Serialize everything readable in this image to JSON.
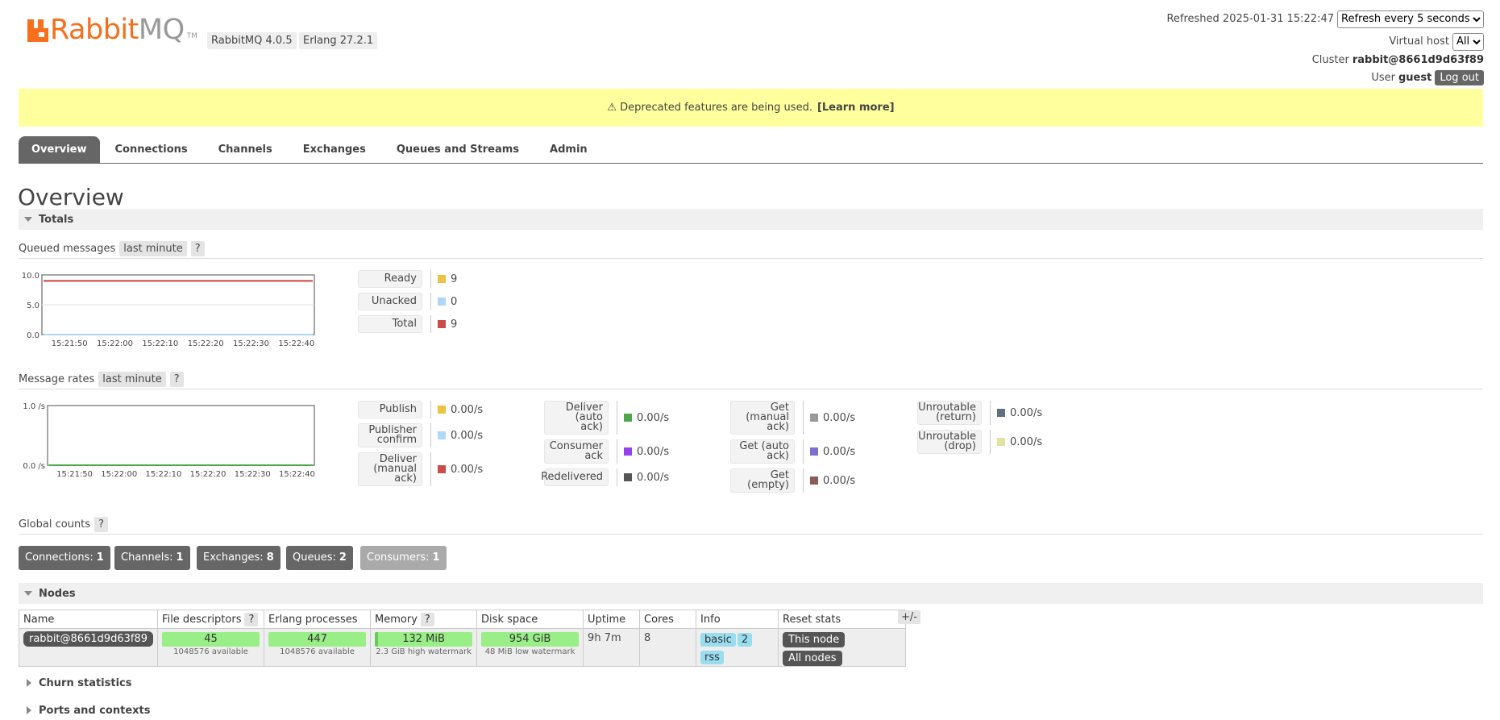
{
  "header": {
    "logo_word_a": "Rabbit",
    "logo_word_b": "MQ",
    "logo_tm": "TM",
    "version_badge": "RabbitMQ 4.0.5",
    "erlang_badge": "Erlang 27.2.1",
    "refreshed_label": "Refreshed 2025-01-31 15:22:47",
    "refresh_option": "Refresh every 5 seconds",
    "vhost_label": "Virtual host",
    "vhost_option": "All",
    "cluster_label": "Cluster",
    "cluster_name": "rabbit@8661d9d63f89",
    "user_label": "User",
    "user_name": "guest",
    "logout_label": "Log out"
  },
  "warning": {
    "text": "⚠ Deprecated features are being used.",
    "link": "[Learn more]"
  },
  "tabs": [
    "Overview",
    "Connections",
    "Channels",
    "Exchanges",
    "Queues and Streams",
    "Admin"
  ],
  "page_title": "Overview",
  "totals": {
    "title": "Totals",
    "queued_label": "Queued messages",
    "queued_range": "last minute",
    "help": "?",
    "rates_label": "Message rates",
    "rates_range": "last minute"
  },
  "queued_legend": [
    {
      "label": "Ready",
      "value": "9",
      "color": "#edc240"
    },
    {
      "label": "Unacked",
      "value": "0",
      "color": "#afd8f8"
    },
    {
      "label": "Total",
      "value": "9",
      "color": "#cb4b4b"
    }
  ],
  "rates_legend": [
    [
      {
        "label": "Publish",
        "value": "0.00/s",
        "color": "#edc240"
      },
      {
        "label": "Publisher confirm",
        "value": "0.00/s",
        "color": "#afd8f8"
      },
      {
        "label": "Deliver (manual ack)",
        "value": "0.00/s",
        "color": "#cb4b4b"
      }
    ],
    [
      {
        "label": "Deliver (auto ack)",
        "value": "0.00/s",
        "color": "#4da74d"
      },
      {
        "label": "Consumer ack",
        "value": "0.00/s",
        "color": "#9440ed"
      },
      {
        "label": "Redelivered",
        "value": "0.00/s",
        "color": "#555555"
      }
    ],
    [
      {
        "label": "Get (manual ack)",
        "value": "0.00/s",
        "color": "#999999"
      },
      {
        "label": "Get (auto ack)",
        "value": "0.00/s",
        "color": "#7d6fd0"
      },
      {
        "label": "Get (empty)",
        "value": "0.00/s",
        "color": "#8d5a5a"
      }
    ],
    [
      {
        "label": "Unroutable (return)",
        "value": "0.00/s",
        "color": "#606f80"
      },
      {
        "label": "Unroutable (drop)",
        "value": "0.00/s",
        "color": "#e0e3a0"
      }
    ]
  ],
  "chart_data": [
    {
      "type": "line",
      "x": [
        "15:21:50",
        "15:22:00",
        "15:22:10",
        "15:22:20",
        "15:22:30",
        "15:22:40"
      ],
      "yticks": [
        "0.0",
        "5.0",
        "10.0"
      ],
      "ylim": [
        0,
        10
      ],
      "series": [
        {
          "name": "Ready",
          "values": [
            9,
            9,
            9,
            9,
            9,
            9
          ],
          "color": "#edc240"
        },
        {
          "name": "Unacked",
          "values": [
            0,
            0,
            0,
            0,
            0,
            0
          ],
          "color": "#afd8f8"
        },
        {
          "name": "Total",
          "values": [
            9,
            9,
            9,
            9,
            9,
            9
          ],
          "color": "#cb4b4b"
        }
      ]
    },
    {
      "type": "line",
      "x": [
        "15:21:50",
        "15:22:00",
        "15:22:10",
        "15:22:20",
        "15:22:30",
        "15:22:40"
      ],
      "yticks": [
        "0.0 /s",
        "1.0 /s"
      ],
      "ylim": [
        0,
        1
      ],
      "series": [
        {
          "name": "Publish",
          "values": [
            0,
            0,
            0,
            0,
            0,
            0
          ],
          "color": "#edc240"
        },
        {
          "name": "Deliver (auto ack)",
          "values": [
            0,
            0,
            0,
            0,
            0,
            0
          ],
          "color": "#4da74d"
        }
      ]
    }
  ],
  "global_counts": {
    "label": "Global counts",
    "help": "?",
    "items": [
      {
        "label": "Connections:",
        "value": "1"
      },
      {
        "label": "Channels:",
        "value": "1"
      },
      {
        "label": "Exchanges:",
        "value": "8"
      },
      {
        "label": "Queues:",
        "value": "2"
      },
      {
        "label": "Consumers:",
        "value": "1"
      }
    ]
  },
  "nodes": {
    "title": "Nodes",
    "headers": [
      "Name",
      "File descriptors",
      "Erlang processes",
      "Memory",
      "Disk space",
      "Uptime",
      "Cores",
      "Info",
      "Reset stats"
    ],
    "help": "?",
    "plusminus": "+/-",
    "row": {
      "name": "rabbit@8661d9d63f89",
      "fd": "45",
      "fd_sub": "1048576 available",
      "proc": "447",
      "proc_sub": "1048576 available",
      "mem": "132 MiB",
      "mem_sub": "2.3 GiB high watermark",
      "disk": "954 GiB",
      "disk_sub": "48 MiB low watermark",
      "uptime": "9h 7m",
      "cores": "8",
      "info": [
        "basic",
        "2",
        "rss"
      ],
      "reset_this": "This node",
      "reset_all": "All nodes"
    }
  },
  "collapsed_sections": [
    "Churn statistics",
    "Ports and contexts"
  ]
}
